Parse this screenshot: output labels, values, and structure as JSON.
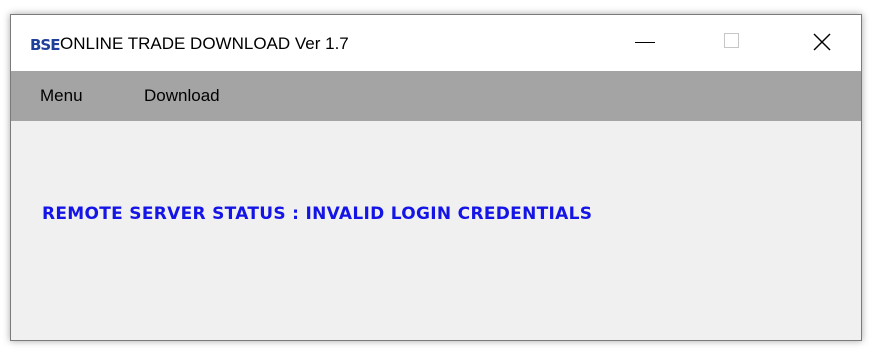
{
  "window": {
    "title": "ONLINE TRADE DOWNLOAD Ver 1.7",
    "app_icon_text": "BSE",
    "controls": [
      "minimize-icon",
      "maximize-icon",
      "close-icon"
    ]
  },
  "menubar": {
    "items": [
      {
        "label": "Menu"
      },
      {
        "label": "Download"
      }
    ]
  },
  "status": {
    "text": "REMOTE SERVER STATUS : INVALID LOGIN CREDENTIALS",
    "color": "#1414e6"
  },
  "colors": {
    "menubar_bg": "#a4a4a4",
    "window_bg": "#f0f0f0",
    "titlebar_bg": "#ffffff"
  }
}
